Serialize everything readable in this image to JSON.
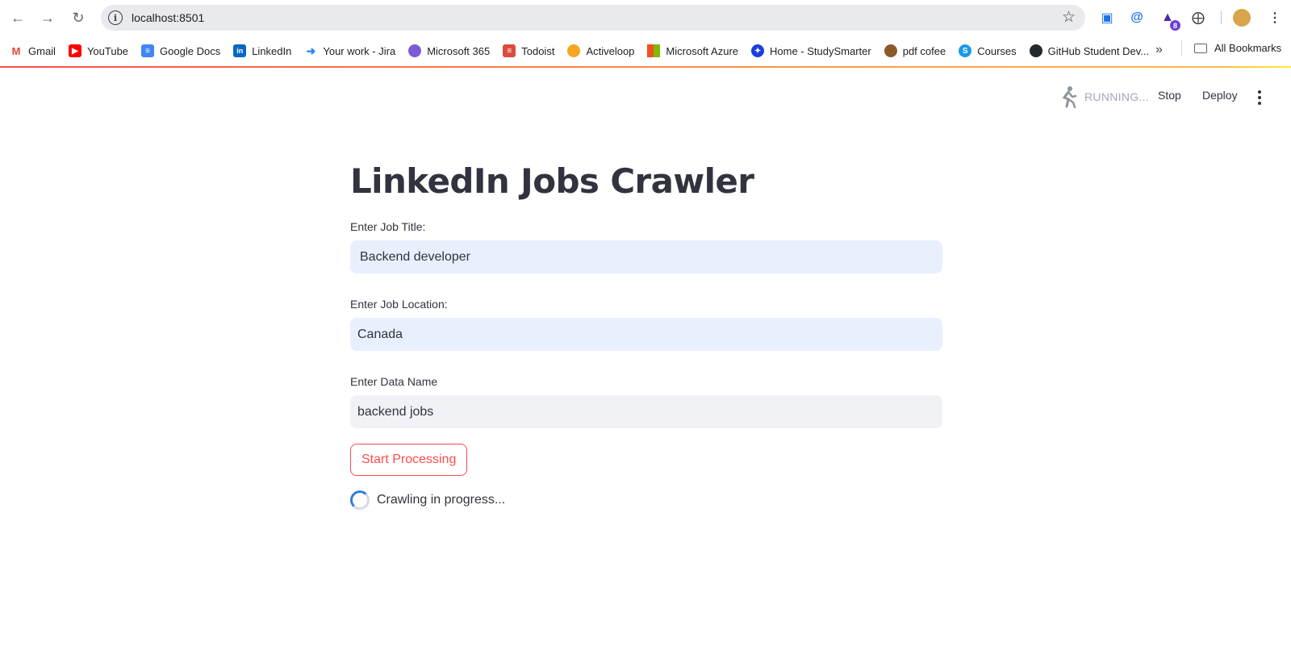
{
  "browser": {
    "url": "localhost:8501",
    "extension_badge": "8"
  },
  "bookmarks": [
    {
      "label": "Gmail",
      "icon": "gmail-icon",
      "color": "#ea4335"
    },
    {
      "label": "YouTube",
      "icon": "youtube-icon",
      "color": "#ff0000"
    },
    {
      "label": "Google Docs",
      "icon": "google-docs-icon",
      "color": "#4285f4"
    },
    {
      "label": "LinkedIn",
      "icon": "linkedin-icon",
      "color": "#0a66c2"
    },
    {
      "label": "Your work - Jira",
      "icon": "jira-icon",
      "color": "#2684ff"
    },
    {
      "label": "Microsoft 365",
      "icon": "microsoft-365-icon",
      "color": "#7b5cd6"
    },
    {
      "label": "Todoist",
      "icon": "todoist-icon",
      "color": "#db4c3f"
    },
    {
      "label": "Activeloop",
      "icon": "activeloop-icon",
      "color": "#f5a623"
    },
    {
      "label": "Microsoft Azure",
      "icon": "microsoft-azure-icon",
      "color": "#f25022"
    },
    {
      "label": "Home - StudySmarter",
      "icon": "studysmarter-icon",
      "color": "#1a3de0"
    },
    {
      "label": "pdf cofee",
      "icon": "pdf-cofee-icon",
      "color": "#8b5a2b"
    },
    {
      "label": "Courses",
      "icon": "courses-icon",
      "color": "#1a9ae6"
    },
    {
      "label": "GitHub Student Dev...",
      "icon": "github-icon",
      "color": "#24292e"
    }
  ],
  "all_bookmarks_label": "All Bookmarks",
  "toolbar": {
    "status": "RUNNING...",
    "stop_label": "Stop",
    "deploy_label": "Deploy"
  },
  "app": {
    "title": "LinkedIn Jobs Crawler",
    "job_title_label": "Enter Job Title:",
    "job_title_value": "Backend developer",
    "job_location_label": "Enter Job Location:",
    "job_location_value": "Canada",
    "data_name_label": "Enter Data Name",
    "data_name_value": "backend jobs",
    "start_button": "Start Processing",
    "progress_text": "Crawling in progress..."
  },
  "colors": {
    "accent": "#ff4b4b",
    "text": "#31333f",
    "autofill_bg": "#e8f0fe",
    "input_bg": "#f0f2f6"
  }
}
